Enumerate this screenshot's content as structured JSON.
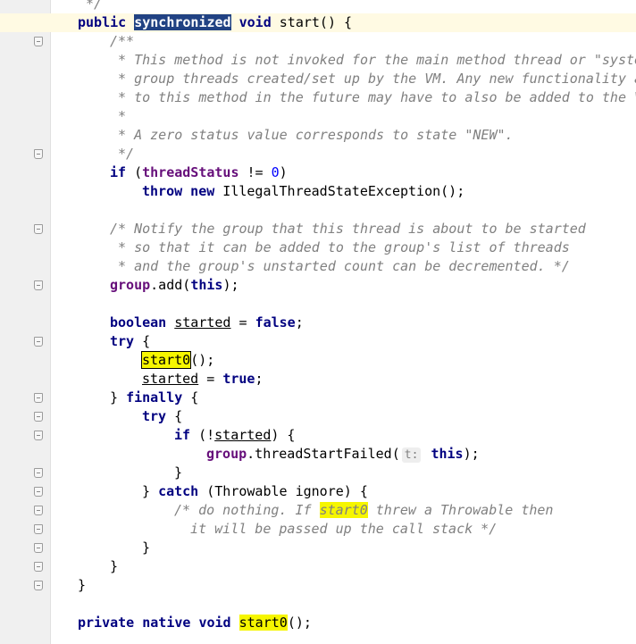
{
  "lines": [
    {
      "indent": 1,
      "segs": [
        {
          "c": "cm",
          "t": " */"
        }
      ]
    },
    {
      "indent": 1,
      "segs": [
        {
          "c": "kw",
          "t": "public"
        },
        {
          "t": " "
        },
        {
          "c": "sel",
          "t": "synchronized"
        },
        {
          "t": " "
        },
        {
          "c": "kw",
          "t": "void"
        },
        {
          "t": " start() {"
        }
      ],
      "current": true
    },
    {
      "indent": 2,
      "segs": [
        {
          "c": "cm",
          "t": "/**"
        }
      ]
    },
    {
      "indent": 2,
      "segs": [
        {
          "c": "cm",
          "t": " * This method is not invoked for the main method thread or \"syste"
        }
      ]
    },
    {
      "indent": 2,
      "segs": [
        {
          "c": "cm",
          "t": " * group threads created/set up by the VM. Any new functionality a"
        }
      ]
    },
    {
      "indent": 2,
      "segs": [
        {
          "c": "cm",
          "t": " * to this method in the future may have to also be added to the V"
        }
      ]
    },
    {
      "indent": 2,
      "segs": [
        {
          "c": "cm",
          "t": " *"
        }
      ]
    },
    {
      "indent": 2,
      "segs": [
        {
          "c": "cm",
          "t": " * A zero status value corresponds to state \"NEW\"."
        }
      ]
    },
    {
      "indent": 2,
      "segs": [
        {
          "c": "cm",
          "t": " */"
        }
      ]
    },
    {
      "indent": 2,
      "segs": [
        {
          "c": "kw",
          "t": "if"
        },
        {
          "t": " ("
        },
        {
          "c": "fld",
          "t": "threadStatus"
        },
        {
          "t": " != "
        },
        {
          "c": "num",
          "t": "0"
        },
        {
          "t": ")"
        }
      ]
    },
    {
      "indent": 3,
      "segs": [
        {
          "c": "kw",
          "t": "throw new"
        },
        {
          "t": " IllegalThreadStateException();"
        }
      ]
    },
    {
      "indent": 0,
      "segs": []
    },
    {
      "indent": 2,
      "segs": [
        {
          "c": "cm",
          "t": "/* Notify the group that this thread is about to be started"
        }
      ]
    },
    {
      "indent": 2,
      "segs": [
        {
          "c": "cm",
          "t": " * so that it can be added to the group's list of threads"
        }
      ]
    },
    {
      "indent": 2,
      "segs": [
        {
          "c": "cm",
          "t": " * and the group's unstarted count can be decremented. */"
        }
      ]
    },
    {
      "indent": 2,
      "segs": [
        {
          "c": "fld",
          "t": "group"
        },
        {
          "t": ".add("
        },
        {
          "c": "kw",
          "t": "this"
        },
        {
          "t": ");"
        }
      ]
    },
    {
      "indent": 0,
      "segs": []
    },
    {
      "indent": 2,
      "segs": [
        {
          "c": "kw",
          "t": "boolean"
        },
        {
          "t": " "
        },
        {
          "c": "unused",
          "t": "started"
        },
        {
          "t": " = "
        },
        {
          "c": "kw",
          "t": "false"
        },
        {
          "t": ";"
        }
      ]
    },
    {
      "indent": 2,
      "segs": [
        {
          "c": "kw",
          "t": "try"
        },
        {
          "t": " {"
        }
      ]
    },
    {
      "indent": 3,
      "segs": [
        {
          "c": "hl-box",
          "t": "start0"
        },
        {
          "t": "();"
        }
      ]
    },
    {
      "indent": 3,
      "segs": [
        {
          "c": "unused",
          "t": "started"
        },
        {
          "t": " = "
        },
        {
          "c": "kw",
          "t": "true"
        },
        {
          "t": ";"
        }
      ]
    },
    {
      "indent": 2,
      "segs": [
        {
          "t": "} "
        },
        {
          "c": "kw",
          "t": "finally"
        },
        {
          "t": " {"
        }
      ]
    },
    {
      "indent": 3,
      "segs": [
        {
          "c": "kw",
          "t": "try"
        },
        {
          "t": " {"
        }
      ]
    },
    {
      "indent": 4,
      "segs": [
        {
          "c": "kw",
          "t": "if"
        },
        {
          "t": " (!"
        },
        {
          "c": "unused",
          "t": "started"
        },
        {
          "t": ") {"
        }
      ]
    },
    {
      "indent": 5,
      "segs": [
        {
          "c": "fld",
          "t": "group"
        },
        {
          "t": ".threadStartFailed("
        },
        {
          "c": "hint",
          "t": "t:"
        },
        {
          "t": " "
        },
        {
          "c": "kw",
          "t": "this"
        },
        {
          "t": ");"
        }
      ]
    },
    {
      "indent": 4,
      "segs": [
        {
          "t": "}"
        }
      ]
    },
    {
      "indent": 3,
      "segs": [
        {
          "t": "} "
        },
        {
          "c": "kw",
          "t": "catch"
        },
        {
          "t": " (Throwable ignore) {"
        }
      ]
    },
    {
      "indent": 4,
      "segs": [
        {
          "c": "cm",
          "t": "/* do nothing. If "
        },
        {
          "c": "cm hl",
          "t": "start0"
        },
        {
          "c": "cm",
          "t": " threw a Throwable then"
        }
      ]
    },
    {
      "indent": 4,
      "segs": [
        {
          "c": "cm",
          "t": "  it will be passed up the call stack */"
        }
      ]
    },
    {
      "indent": 3,
      "segs": [
        {
          "t": "}"
        }
      ]
    },
    {
      "indent": 2,
      "segs": [
        {
          "t": "}"
        }
      ]
    },
    {
      "indent": 1,
      "segs": [
        {
          "t": "}"
        }
      ]
    },
    {
      "indent": 0,
      "segs": []
    },
    {
      "indent": 1,
      "segs": [
        {
          "c": "kw",
          "t": "private native void"
        },
        {
          "t": " "
        },
        {
          "c": "hl",
          "t": "start0"
        },
        {
          "t": "();"
        }
      ]
    }
  ],
  "fold_marker_lines": [
    1,
    2,
    8,
    12,
    15,
    18,
    21,
    22,
    23,
    25,
    26,
    27,
    28,
    29,
    30,
    31
  ]
}
